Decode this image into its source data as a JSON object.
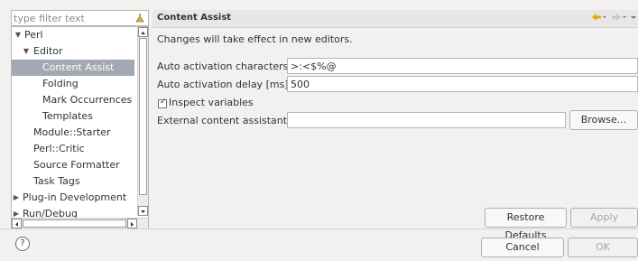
{
  "filter": {
    "placeholder": "type filter text"
  },
  "tree": {
    "items": [
      {
        "label": "Perl",
        "expanded": true
      },
      {
        "label": "Editor",
        "expanded": true
      },
      {
        "label": "Content Assist",
        "selected": true
      },
      {
        "label": "Folding"
      },
      {
        "label": "Mark Occurrences"
      },
      {
        "label": "Templates"
      },
      {
        "label": "Module::Starter"
      },
      {
        "label": "Perl::Critic"
      },
      {
        "label": "Source Formatter"
      },
      {
        "label": "Task Tags"
      },
      {
        "label": "Plug-in Development",
        "expanded": false
      },
      {
        "label": "Run/Debug",
        "expanded": false
      }
    ]
  },
  "page": {
    "title": "Content Assist",
    "notice": "Changes will take effect in new editors.",
    "auto_activation_chars_label": "Auto activation characters",
    "auto_activation_chars_value": ">:<$%@",
    "auto_activation_delay_label": "Auto activation delay [ms]",
    "auto_activation_delay_value": "500",
    "inspect_variables_label": "Inspect variables",
    "inspect_variables_checked": true,
    "external_assistant_label": "External content assistant",
    "external_assistant_value": "",
    "browse_label": "Browse...",
    "restore_defaults_label": "Restore Defaults",
    "apply_label": "Apply"
  },
  "footer": {
    "help_label": "?",
    "cancel_label": "Cancel",
    "ok_label": "OK"
  },
  "icons": {
    "clear_filter": "clear-filter-icon",
    "back": "back-arrow-icon",
    "forward": "forward-arrow-icon",
    "help": "help-icon"
  },
  "colors": {
    "selection": "#a2a9b2",
    "background": "#f2f1f0",
    "nav_accent": "#e5a50a"
  }
}
